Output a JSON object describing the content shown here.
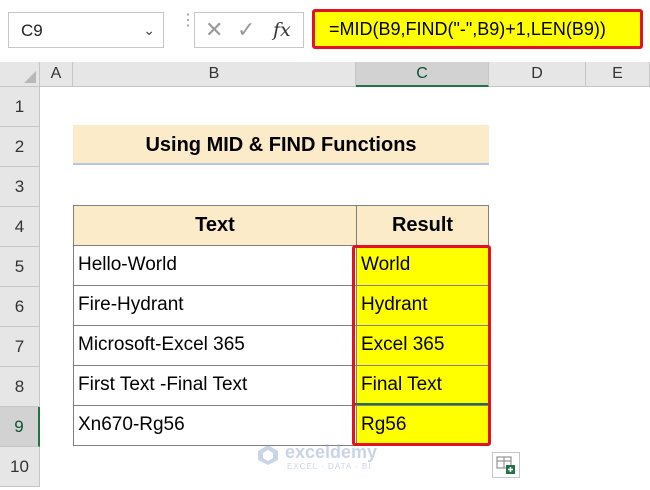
{
  "formula_bar": {
    "name_box": "C9",
    "formula": "=MID(B9,FIND(\"-\",B9)+1,LEN(B9))",
    "cancel_icon": "close-icon",
    "enter_icon": "check-icon",
    "fx_label": "fx"
  },
  "columns": [
    "A",
    "B",
    "C",
    "D",
    "E"
  ],
  "rows": [
    "1",
    "2",
    "3",
    "4",
    "5",
    "6",
    "7",
    "8",
    "9",
    "10"
  ],
  "sheet": {
    "title": "Using MID & FIND Functions",
    "header": {
      "text": "Text",
      "result": "Result"
    },
    "data": [
      {
        "text": "Hello-World",
        "result": "World"
      },
      {
        "text": "Fire-Hydrant",
        "result": "Hydrant"
      },
      {
        "text": "Microsoft-Excel 365",
        "result": "Excel 365"
      },
      {
        "text": "First Text -Final Text",
        "result": "Final Text"
      },
      {
        "text": "Xn670-Rg56",
        "result": "Rg56"
      }
    ]
  },
  "watermark": {
    "name": "exceldemy",
    "tagline": "EXCEL · DATA · BI"
  },
  "colors": {
    "highlight": "#ffff00",
    "outline": "#e3121e",
    "header_fill": "#fcebc8",
    "selection": "#217346"
  }
}
